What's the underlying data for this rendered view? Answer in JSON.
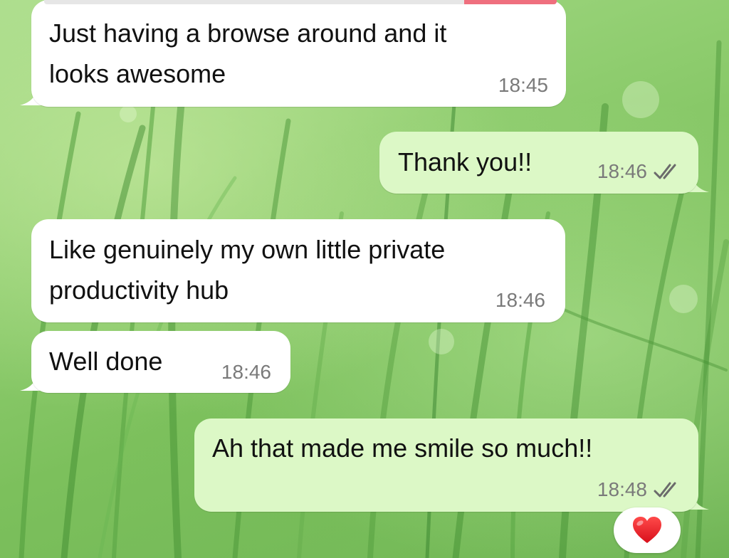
{
  "theme": {
    "incoming_bubble": "#ffffff",
    "outgoing_bubble": "#dcf8c6",
    "timestamp_color": "#7a7a7a",
    "read_receipt_color": "#6b6b6b",
    "wallpaper": "green grass"
  },
  "messages": [
    {
      "direction": "incoming",
      "lines": [
        "Just having a browse around and it",
        "looks awesome"
      ],
      "time": "18:45"
    },
    {
      "direction": "outgoing",
      "lines": [
        "Thank you!!"
      ],
      "time": "18:46",
      "receipt": "read-double-check"
    },
    {
      "direction": "incoming",
      "lines": [
        "Like genuinely my own little private",
        "productivity hub"
      ],
      "time": "18:46"
    },
    {
      "direction": "incoming",
      "lines": [
        "Well done"
      ],
      "time": "18:46"
    },
    {
      "direction": "outgoing",
      "lines": [
        "Ah that made me smile so much!!"
      ],
      "time": "18:48",
      "receipt": "read-double-check"
    }
  ],
  "reaction": {
    "emoji": "heart-icon",
    "target_message": 4
  }
}
